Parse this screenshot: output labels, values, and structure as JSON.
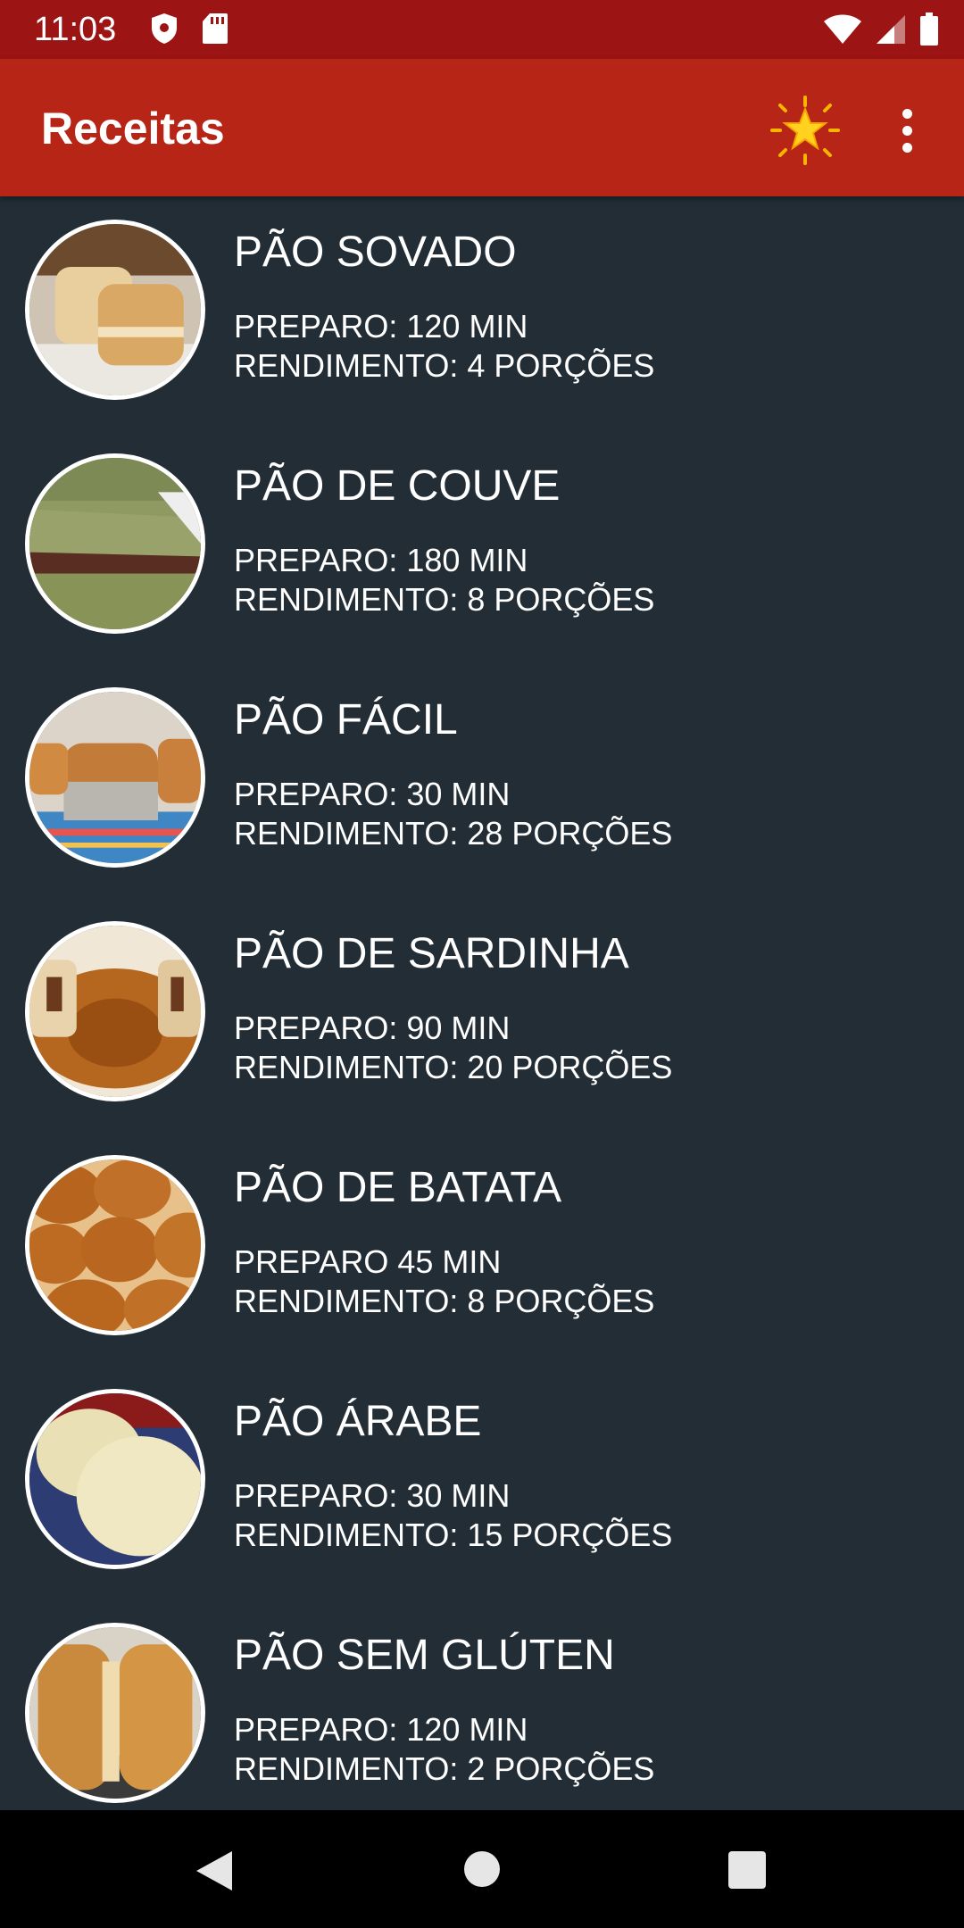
{
  "status_bar": {
    "time": "11:03",
    "icons": [
      "shield-icon",
      "sd-card-icon",
      "wifi-icon",
      "signal-icon",
      "battery-icon"
    ]
  },
  "app_bar": {
    "title": "Receitas",
    "action_icon": "star-icon",
    "overflow_icon": "more-vert-icon"
  },
  "colors": {
    "status_bar": "#9c1413",
    "app_bar": "#b72516",
    "background": "#222d35",
    "text": "#ffffff"
  },
  "recipes": [
    {
      "title": "PÃO SOVADO",
      "prep": "PREPARO: 120 MIN",
      "yield": "RENDIMENTO: 4 PORÇÕES",
      "image": "bread-loaf-image"
    },
    {
      "title": "PÃO DE COUVE",
      "prep": "PREPARO: 180 MIN",
      "yield": "RENDIMENTO: 8 PORÇÕES",
      "image": "kale-bread-sandwich-image"
    },
    {
      "title": "PÃO FÁCIL",
      "prep": "PREPARO: 30 MIN",
      "yield": "RENDIMENTO: 28 PORÇÕES",
      "image": "pan-loaves-image"
    },
    {
      "title": "PÃO DE SARDINHA",
      "prep": "PREPARO: 90 MIN",
      "yield": "RENDIMENTO: 20 PORÇÕES",
      "image": "sardine-bread-ring-image"
    },
    {
      "title": "PÃO DE BATATA",
      "prep": "PREPARO 45 MIN",
      "yield": "RENDIMENTO: 8 PORÇÕES",
      "image": "potato-rolls-image"
    },
    {
      "title": "PÃO ÁRABE",
      "prep": "PREPARO: 30 MIN",
      "yield": "RENDIMENTO: 15 PORÇÕES",
      "image": "pita-bread-image"
    },
    {
      "title": "PÃO SEM GLÚTEN",
      "prep": "PREPARO: 120 MIN",
      "yield": "RENDIMENTO: 2 PORÇÕES",
      "image": "gluten-free-loaves-image"
    }
  ],
  "nav_bar": {
    "icons": [
      "back-icon",
      "home-icon",
      "recents-icon"
    ]
  }
}
